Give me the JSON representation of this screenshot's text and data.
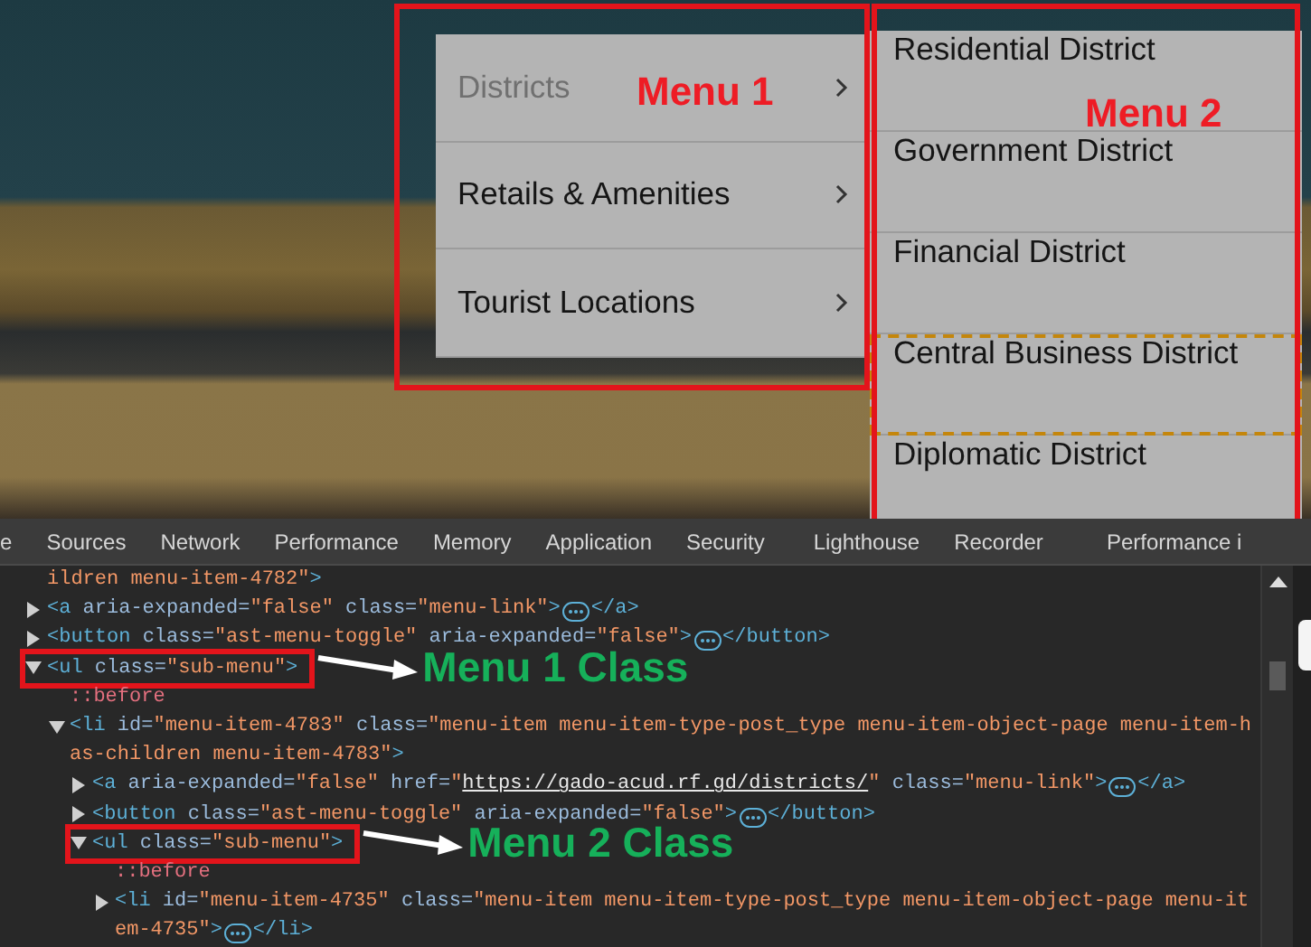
{
  "menu_1": {
    "annotation": "Menu 1",
    "items": [
      {
        "label": "Districts",
        "active": true
      },
      {
        "label": "Retails & Amenities",
        "active": false
      },
      {
        "label": "Tourist Locations",
        "active": false
      }
    ]
  },
  "menu_2": {
    "annotation": "Menu 2",
    "items": [
      {
        "label": "Residential District",
        "highlighted": false
      },
      {
        "label": "Government District",
        "highlighted": false
      },
      {
        "label": "Financial District",
        "highlighted": false
      },
      {
        "label": "Central Business District",
        "highlighted": true
      },
      {
        "label": "Diplomatic District",
        "highlighted": false
      }
    ]
  },
  "devtools_tabs": [
    "e",
    "Sources",
    "Network",
    "Performance",
    "Memory",
    "Application",
    "Security",
    "Lighthouse",
    "Recorder",
    "Performance i"
  ],
  "dom": [
    {
      "kind": "text",
      "tokens": [
        {
          "kind": "value",
          "text": "ildren menu-item-4782\""
        },
        {
          "kind": "tag",
          "text": ">"
        }
      ]
    },
    {
      "kind": "element",
      "expanded": false,
      "tokens": [
        {
          "kind": "tag",
          "text": "<a"
        },
        {
          "kind": "attr",
          "text": " aria-expanded="
        },
        {
          "kind": "value",
          "text": "\"false\""
        },
        {
          "kind": "attr",
          "text": " class="
        },
        {
          "kind": "value",
          "text": "\"menu-link\""
        },
        {
          "kind": "tag",
          "text": ">"
        },
        {
          "kind": "more"
        },
        {
          "kind": "tag",
          "text": "</a>"
        }
      ]
    },
    {
      "kind": "element",
      "expanded": false,
      "tokens": [
        {
          "kind": "tag",
          "text": "<button"
        },
        {
          "kind": "attr",
          "text": " class="
        },
        {
          "kind": "value",
          "text": "\"ast-menu-toggle\""
        },
        {
          "kind": "attr",
          "text": " aria-expanded="
        },
        {
          "kind": "value",
          "text": "\"false\""
        },
        {
          "kind": "tag",
          "text": ">"
        },
        {
          "kind": "more"
        },
        {
          "kind": "tag",
          "text": "</button>"
        }
      ]
    },
    {
      "kind": "element",
      "expanded": true,
      "callout": "Menu 1 Class",
      "tokens": [
        {
          "kind": "tag",
          "text": "<ul"
        },
        {
          "kind": "attr",
          "text": " class="
        },
        {
          "kind": "value",
          "text": "\"sub-menu\""
        },
        {
          "kind": "tag",
          "text": ">"
        }
      ],
      "children": [
        {
          "kind": "pseudo",
          "tokens": [
            {
              "kind": "pseudo",
              "text": "::before"
            }
          ]
        },
        {
          "kind": "element",
          "expanded": true,
          "tokens": [
            {
              "kind": "tag",
              "text": "<li"
            },
            {
              "kind": "attr",
              "text": " id="
            },
            {
              "kind": "value",
              "text": "\"menu-item-4783\""
            },
            {
              "kind": "attr",
              "text": " class="
            },
            {
              "kind": "value",
              "text": "\"menu-item menu-item-type-post_type menu-item-object-page menu-item-has-children menu-item-4783\""
            },
            {
              "kind": "tag",
              "text": ">"
            }
          ],
          "children": [
            {
              "kind": "element",
              "expanded": false,
              "tokens": [
                {
                  "kind": "tag",
                  "text": "<a"
                },
                {
                  "kind": "attr",
                  "text": " aria-expanded="
                },
                {
                  "kind": "value",
                  "text": "\"false\""
                },
                {
                  "kind": "attr",
                  "text": " href="
                },
                {
                  "kind": "value",
                  "text": "\""
                },
                {
                  "kind": "link",
                  "text": "https://gado-acud.rf.gd/districts/"
                },
                {
                  "kind": "value",
                  "text": "\""
                },
                {
                  "kind": "attr",
                  "text": " class="
                },
                {
                  "kind": "value",
                  "text": "\"menu-link\""
                },
                {
                  "kind": "tag",
                  "text": ">"
                },
                {
                  "kind": "more"
                },
                {
                  "kind": "tag",
                  "text": "</a>"
                }
              ]
            },
            {
              "kind": "element",
              "expanded": false,
              "tokens": [
                {
                  "kind": "tag",
                  "text": "<button"
                },
                {
                  "kind": "attr",
                  "text": " class="
                },
                {
                  "kind": "value",
                  "text": "\"ast-menu-toggle\""
                },
                {
                  "kind": "attr",
                  "text": " aria-expanded="
                },
                {
                  "kind": "value",
                  "text": "\"false\""
                },
                {
                  "kind": "tag",
                  "text": ">"
                },
                {
                  "kind": "more"
                },
                {
                  "kind": "tag",
                  "text": "</button>"
                }
              ]
            },
            {
              "kind": "element",
              "expanded": true,
              "callout": "Menu 2 Class",
              "tokens": [
                {
                  "kind": "tag",
                  "text": "<ul"
                },
                {
                  "kind": "attr",
                  "text": " class="
                },
                {
                  "kind": "value",
                  "text": "\"sub-menu\""
                },
                {
                  "kind": "tag",
                  "text": ">"
                }
              ],
              "children": [
                {
                  "kind": "pseudo",
                  "tokens": [
                    {
                      "kind": "pseudo",
                      "text": "::before"
                    }
                  ]
                },
                {
                  "kind": "element",
                  "expanded": false,
                  "tokens": [
                    {
                      "kind": "tag",
                      "text": "<li"
                    },
                    {
                      "kind": "attr",
                      "text": " id="
                    },
                    {
                      "kind": "value",
                      "text": "\"menu-item-4735\""
                    },
                    {
                      "kind": "attr",
                      "text": " class="
                    },
                    {
                      "kind": "value",
                      "text": "\"menu-item menu-item-type-post_type menu-item-object-page menu-it"
                    },
                    {
                      "kind": "break"
                    },
                    {
                      "kind": "value",
                      "text": "em-4735\""
                    },
                    {
                      "kind": "tag",
                      "text": ">"
                    },
                    {
                      "kind": "more"
                    },
                    {
                      "kind": "tag",
                      "text": "</li>"
                    }
                  ]
                }
              ]
            }
          ]
        }
      ]
    }
  ]
}
